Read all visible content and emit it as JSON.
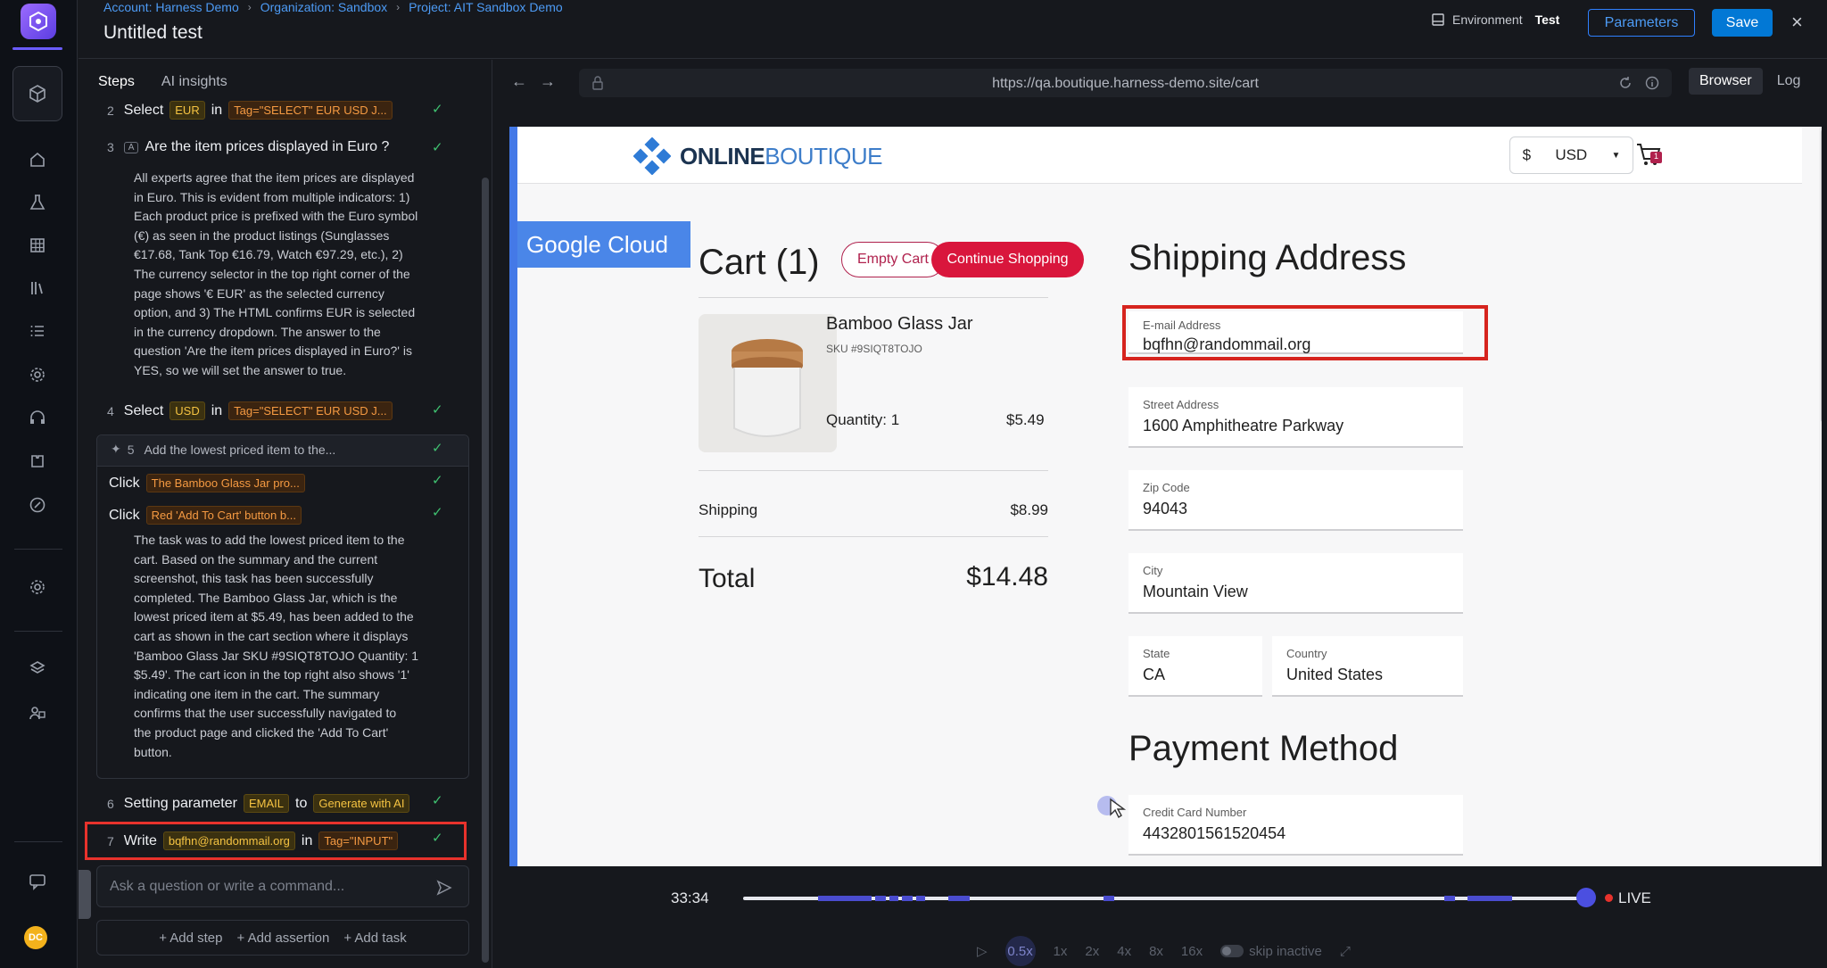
{
  "header": {
    "breadcrumbs": [
      "Account: Harness Demo",
      "Organization: Sandbox",
      "Project: AIT Sandbox Demo"
    ],
    "title": "Untitled test",
    "environment_label": "Environment",
    "environment_value": "Test",
    "parameters_label": "Parameters",
    "save_label": "Save"
  },
  "panel": {
    "tabs": [
      "Steps",
      "AI insights"
    ],
    "steps": [
      {
        "num": "2",
        "verb": "Select",
        "value": "EUR",
        "in": "in",
        "target": "Tag=\"SELECT\" EUR USD J..."
      },
      {
        "num": "3",
        "question": "Are the item prices displayed in Euro ?",
        "badge": "A",
        "explanation": "All experts agree that the item prices are displayed\nin Euro. This is evident from multiple indicators: 1)\nEach product price is prefixed with the Euro symbol\n(€) as seen in the product listings (Sunglasses\n€17.68, Tank Top €16.79, Watch €97.29, etc.), 2)\nThe currency selector in the top right corner of the\npage shows '€ EUR' as the selected currency\noption, and 3) The HTML confirms EUR is selected\nin the currency dropdown. The answer to the\nquestion 'Are the item prices displayed in Euro?' is\nYES, so we will set the answer to true."
      },
      {
        "num": "4",
        "verb": "Select",
        "value": "USD",
        "in": "in",
        "target": "Tag=\"SELECT\" EUR USD J..."
      },
      {
        "num": "5",
        "task": "Add the lowest priced item to the...",
        "clicks": [
          {
            "verb": "Click",
            "target": "The Bamboo Glass Jar pro..."
          },
          {
            "verb": "Click",
            "target": "Red 'Add To Cart' button b..."
          }
        ],
        "explanation": "The task was to add the lowest priced item to the\ncart. Based on the summary and the current\nscreenshot, this task has been successfully\ncompleted. The Bamboo Glass Jar, which is the\nlowest priced item at $5.49, has been added to the\ncart as shown in the cart section where it displays\n'Bamboo Glass Jar SKU #9SIQT8TOJO Quantity: 1\n$5.49'. The cart icon in the top right also shows '1'\nindicating one item in the cart. The summary\nconfirms that the user successfully navigated to\nthe product page and clicked the 'Add To Cart'\nbutton."
      },
      {
        "num": "6",
        "verb": "Setting parameter",
        "value": "EMAIL",
        "in": "to",
        "target": "Generate with AI"
      },
      {
        "num": "7",
        "verb": "Write",
        "value": "bqfhn@randommail.org",
        "in": "in",
        "target": "Tag=\"INPUT\""
      }
    ],
    "chat_placeholder": "Ask a question or write a command...",
    "actions": [
      "+ Add step",
      "+ Add assertion",
      "+ Add task"
    ]
  },
  "browser": {
    "url": "https://qa.boutique.harness-demo.site/cart",
    "view_tabs": [
      "Browser",
      "Log"
    ]
  },
  "site": {
    "logo_bold": "ONLINE",
    "logo_light": "BOUTIQUE",
    "currency_symbol": "$",
    "currency_code": "USD",
    "cart_count": "1",
    "banner": "Google Cloud",
    "cart_title": "Cart (1)",
    "empty_cart": "Empty Cart",
    "continue_shopping": "Continue Shopping",
    "product_name": "Bamboo Glass Jar",
    "product_sku": "SKU #9SIQT8TOJO",
    "quantity": "Quantity: 1",
    "price": "$5.49",
    "shipping_label": "Shipping",
    "shipping_value": "$8.99",
    "total_label": "Total",
    "total_value": "$14.48",
    "shipping_title": "Shipping Address",
    "fields": {
      "email_label": "E-mail Address",
      "email_value": "bqfhn@randommail.org",
      "street_label": "Street Address",
      "street_value": "1600 Amphitheatre Parkway",
      "zip_label": "Zip Code",
      "zip_value": "94043",
      "city_label": "City",
      "city_value": "Mountain View",
      "state_label": "State",
      "state_value": "CA",
      "country_label": "Country",
      "country_value": "United States"
    },
    "payment_title": "Payment Method",
    "card_label": "Credit Card Number",
    "card_value": "4432801561520454"
  },
  "player": {
    "time": "33:34",
    "live": "LIVE",
    "speeds": [
      "0.5x",
      "1x",
      "2x",
      "4x",
      "8x",
      "16x"
    ],
    "skip_label": "skip inactive"
  },
  "colors": {
    "accent": "#0278d5",
    "highlight": "#e8322c",
    "check": "#3fc070",
    "brand_red": "#d9163c"
  }
}
